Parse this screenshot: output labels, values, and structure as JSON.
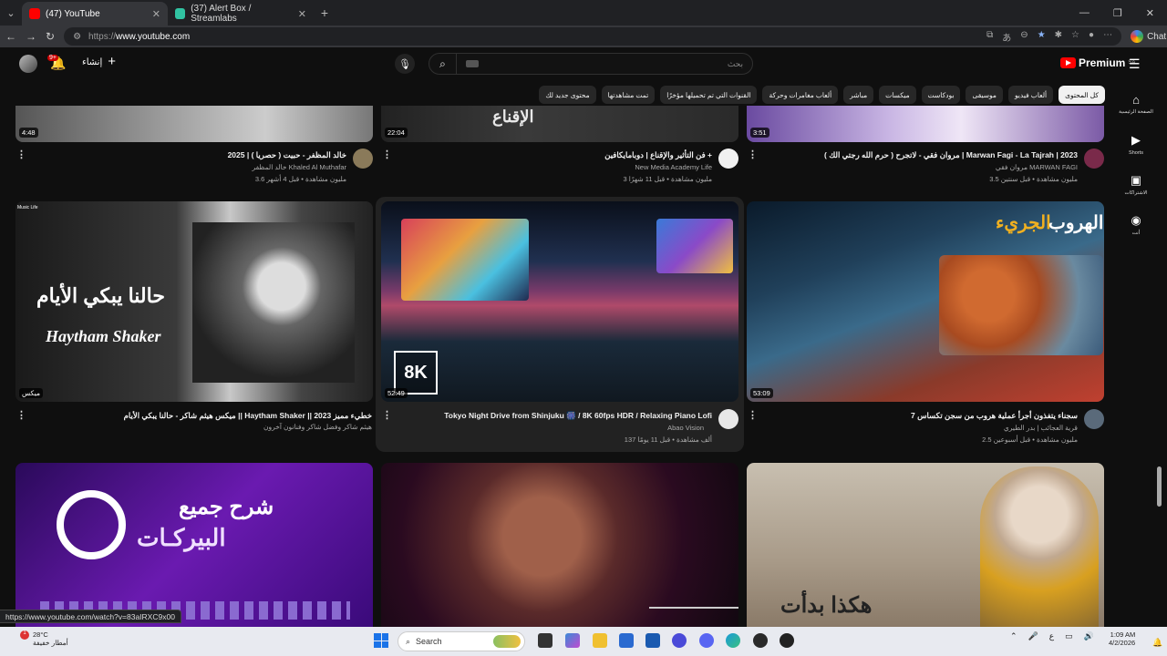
{
  "browser": {
    "tabs": [
      {
        "label": "(47) YouTube",
        "active": true
      },
      {
        "label": "(37) Alert Box / Streamlabs",
        "active": false
      }
    ],
    "url_scheme": "https://",
    "url_host": "www.youtube.com",
    "chat_label": "Chat"
  },
  "header": {
    "create_label": "إنشاء",
    "notif_count": "9+",
    "search_placeholder": "بحث",
    "logo_text": "Premium",
    "logo_region": "SA"
  },
  "chips": [
    "كل المحتوى",
    "ألعاب فيديو",
    "موسيقى",
    "بودكاست",
    "ميكسات",
    "مباشر",
    "ألعاب مغامرات وحركة",
    "القنوات التي تم تحميلها مؤخرًا",
    "تمت مشاهدتها",
    "محتوى جديد لك"
  ],
  "rail": [
    {
      "icon": "home-icon",
      "label": "الصفحة الرئيسية"
    },
    {
      "icon": "shorts-icon",
      "label": "Shorts"
    },
    {
      "icon": "subscriptions-icon",
      "label": "الاشتراكات"
    },
    {
      "icon": "you-icon",
      "label": "أنت"
    }
  ],
  "videos": [
    {
      "title": "خالد المظفر - حبيت ( حصريا ) | 2025",
      "channel": "خالد المظفر Khaled Al Muthafar",
      "meta": "3.6 مليون مشاهدة • قبل 4 أشهر",
      "duration": "4:48"
    },
    {
      "title": "فن التأثير والإقناع | دوبامايكافين +",
      "channel": "New Media Academy Life",
      "meta": "3 مليون مشاهدة • قبل 11 شهرًا",
      "duration": "22:04"
    },
    {
      "title": "مروان فقي - لاتجرح ( حرم الله رجتي الك ) | Marwan Fagi - La Tajrah | 2023",
      "channel": "مروان فقي MARWAN FAGI",
      "meta": "3.5 مليون مشاهدة • قبل سنتين",
      "duration": "3:51"
    },
    {
      "title": "ميكس هيثم شاكر - حالنا يبكي الأيام || Haytham Shaker || خطيء مميز 2023",
      "channel": "هيثم شاكر وفضل شاكر وفنانون آخرون",
      "meta": "",
      "duration": "ميكس"
    },
    {
      "title": "Tokyo Night Drive from Shinjuku 🎆 / 8K 60fps HDR / Relaxing Piano Lofi",
      "channel": "Abao Vision",
      "meta": "137 ألف مشاهدة • قبل 11 يومًا",
      "duration": "52:49"
    },
    {
      "title": "7 سجناء يتفذون أجرأ عملية هروب من سجن تكساس",
      "channel": "قرية العجائب | بدر الطيري",
      "meta": "2.5 مليون مشاهدة • قبل أسبوعين",
      "duration": "53:09"
    }
  ],
  "overlays": {
    "v1_top": "الإقناع",
    "v4_ar": "حالنا يبكي الأيام",
    "v4_en": "Haytham Shaker",
    "v4_corner": "Music Life",
    "v5_badge": "8K",
    "v6_ar1": "الهروب",
    "v6_ar2": "الجريء",
    "v7_ar1": "شرح جميع",
    "v7_ar2": "البيركـات",
    "v9_ar": "هكذا بدأت"
  },
  "status_url": "https://www.youtube.com/watch?v=83aIRXC9x00",
  "taskbar": {
    "weather_temp": "28°C",
    "weather_desc": "أمطار خفيفة",
    "search_label": "Search",
    "time": "1:09 AM",
    "date": "4/2/2026",
    "lang": "ع"
  }
}
